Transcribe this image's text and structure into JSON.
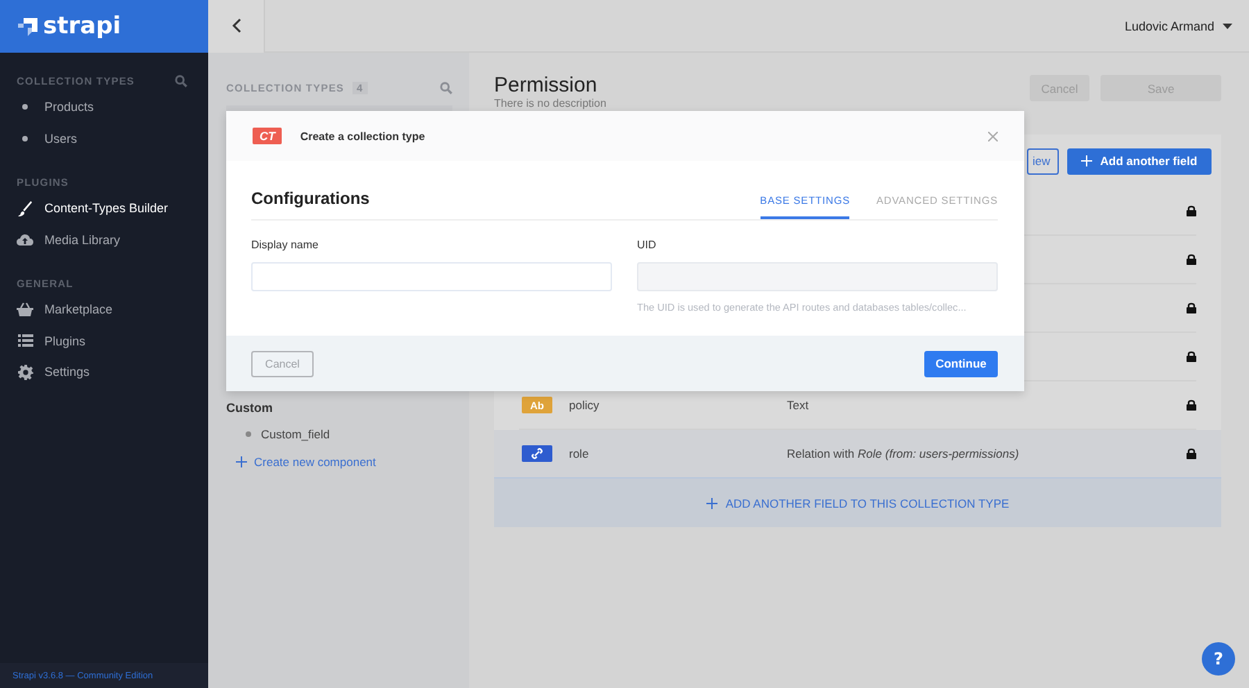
{
  "sidebar": {
    "brand": "strapi",
    "sections": [
      {
        "title": "COLLECTION TYPES",
        "search": true,
        "items": [
          {
            "label": "Products",
            "kind": "dot",
            "selected": false
          },
          {
            "label": "Users",
            "kind": "dot",
            "selected": false
          }
        ]
      },
      {
        "title": "PLUGINS",
        "search": false,
        "items": [
          {
            "label": "Content-Types Builder",
            "kind": "brush",
            "selected": true
          },
          {
            "label": "Media Library",
            "kind": "cloud",
            "selected": false
          }
        ]
      },
      {
        "title": "GENERAL",
        "search": false,
        "items": [
          {
            "label": "Marketplace",
            "kind": "basket",
            "selected": false
          },
          {
            "label": "Plugins",
            "kind": "list",
            "selected": false
          },
          {
            "label": "Settings",
            "kind": "gear",
            "selected": false
          }
        ]
      }
    ],
    "footer": "Strapi v3.6.8 — Community Edition"
  },
  "header": {
    "user": "Ludovic Armand"
  },
  "builder_panel": {
    "title": "COLLECTION TYPES",
    "count": "4",
    "component_group": "Custom",
    "components": [
      "Custom_field"
    ],
    "create_link": "Create new component"
  },
  "content_type": {
    "title": "Permission",
    "description": "There is no description",
    "buttons": [
      "Cancel",
      "Save"
    ],
    "toolbar_buttons": [
      "iew",
      "Add another field"
    ],
    "fields": [
      {
        "kind": "covered"
      },
      {
        "kind": "covered"
      },
      {
        "kind": "covered"
      },
      {
        "kind": "covered"
      },
      {
        "kind": "text",
        "badge": "Ab",
        "name": "policy",
        "type": "Text"
      },
      {
        "kind": "relation",
        "name": "role",
        "type": "Relation with *Role (from: users-permissions)*"
      }
    ],
    "add_field": "ADD ANOTHER FIELD TO THIS COLLECTION TYPE"
  },
  "modal": {
    "badge": "CT",
    "title": "Create a collection type",
    "heading": "Configurations",
    "tabs": [
      {
        "label": "BASE SETTINGS",
        "selected": true
      },
      {
        "label": "ADVANCED SETTINGS",
        "selected": false
      }
    ],
    "fields": [
      {
        "label": "Display name",
        "kind": "text"
      },
      {
        "label": "UID",
        "kind": "uid",
        "hint": "The UID is used to generate the API routes and databases tables/collec..."
      }
    ],
    "buttons": [
      "Cancel",
      "Continue"
    ]
  },
  "help": "?"
}
